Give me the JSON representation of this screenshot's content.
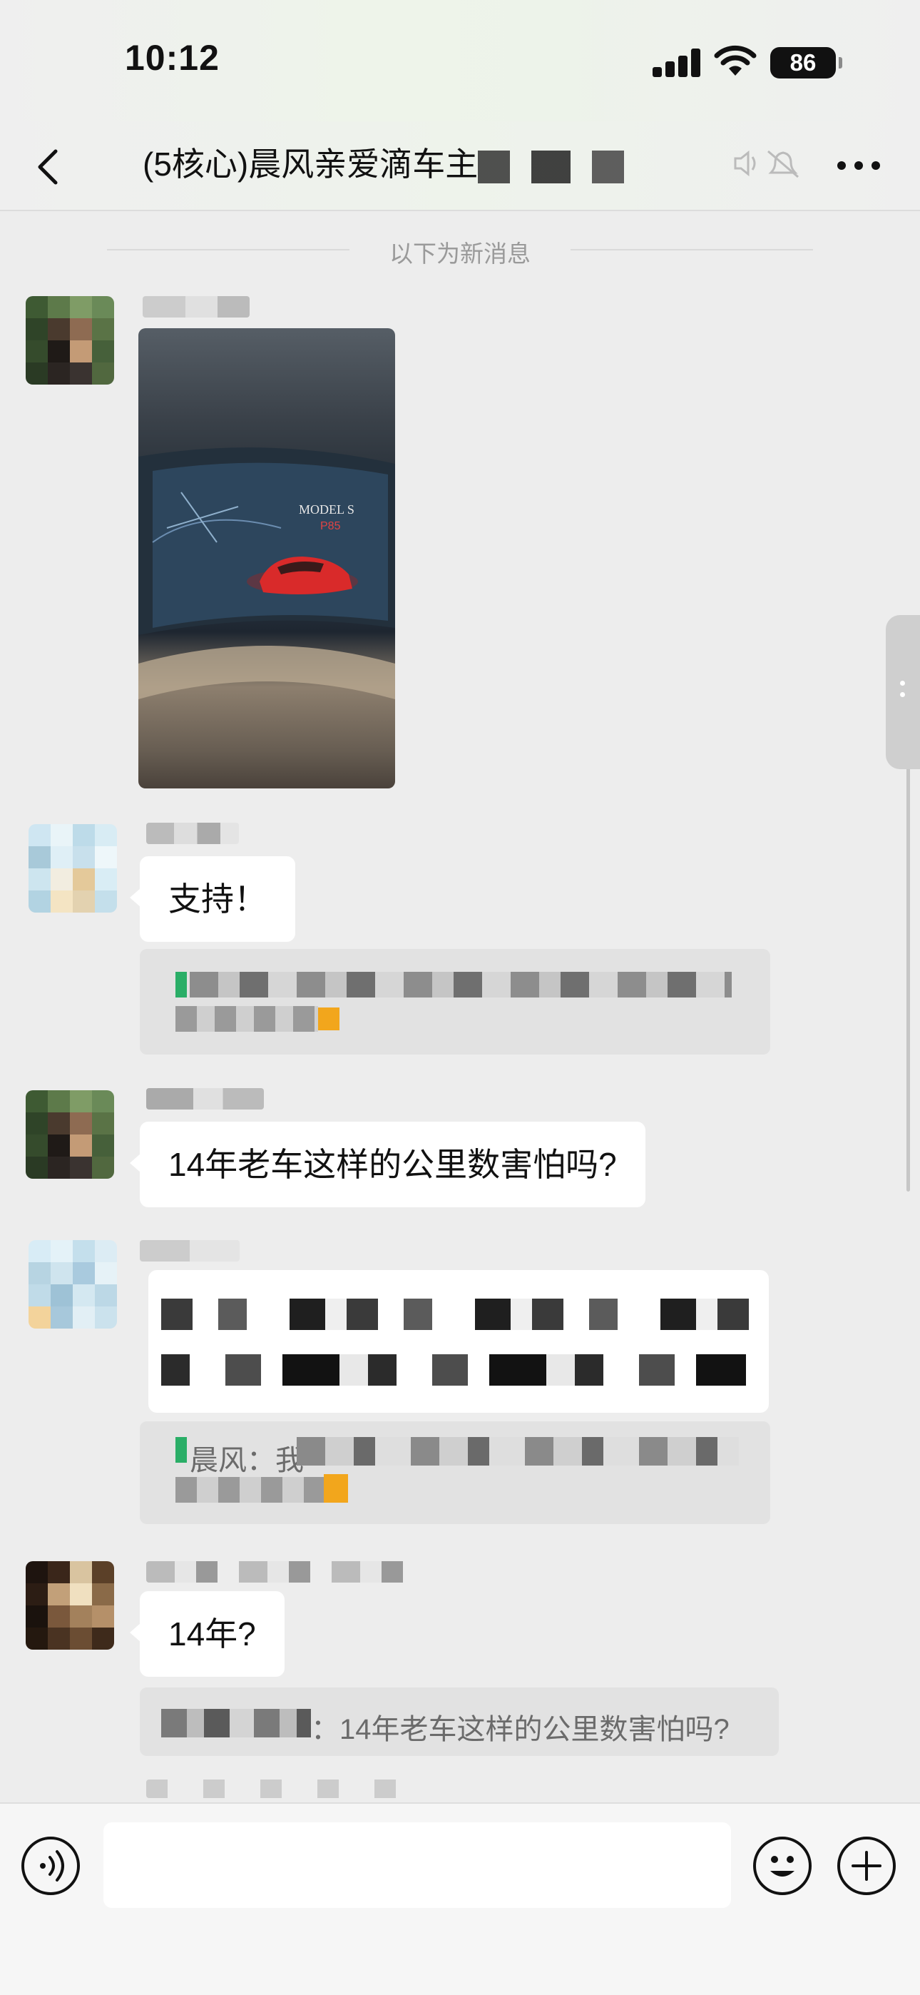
{
  "status_bar": {
    "time": "10:12",
    "battery": "86"
  },
  "header": {
    "back_label": "<",
    "title": "(5核心)晨风亲爱滴车主",
    "more_label": "..."
  },
  "divider": {
    "text": "以下为新消息"
  },
  "messages": [
    {
      "type": "image",
      "caption": "MODEL S"
    },
    {
      "type": "text",
      "text": "支持！",
      "quote_visible": true
    },
    {
      "type": "text",
      "text": "14年老车这样的公里数害怕吗?"
    },
    {
      "type": "text",
      "text": "",
      "quote_text": "晨风：我"
    },
    {
      "type": "text",
      "text": "14年?",
      "quote_text": "：14年老车这样的公里数害怕吗?"
    }
  ],
  "input": {
    "placeholder": ""
  },
  "colors": {
    "background": "#ededed",
    "bubble": "#ffffff",
    "quote_bg": "#e2e2e2",
    "accent_green": "#2aae67"
  }
}
